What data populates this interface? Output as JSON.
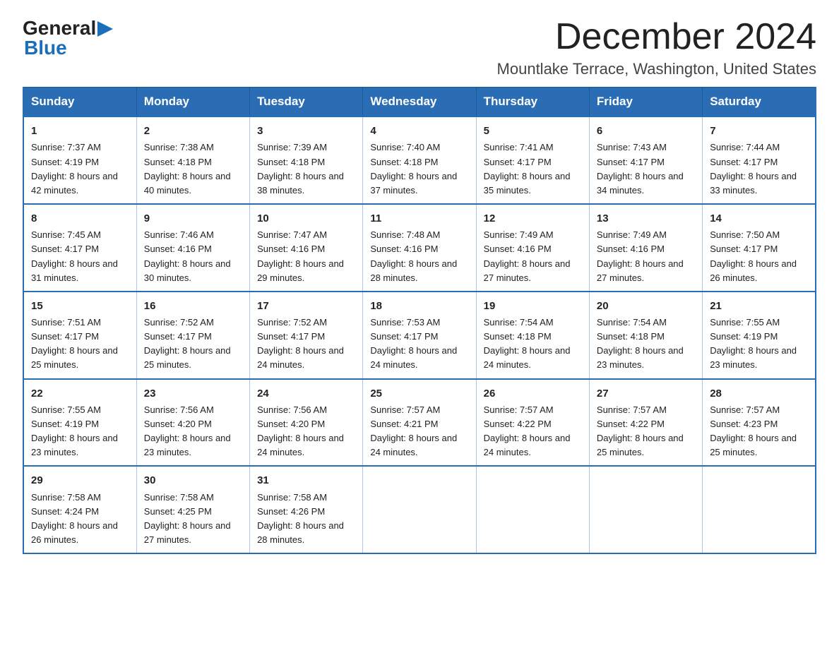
{
  "logo": {
    "text_general": "General",
    "text_blue": "Blue",
    "arrow": "▶"
  },
  "title": "December 2024",
  "subtitle": "Mountlake Terrace, Washington, United States",
  "days_of_week": [
    "Sunday",
    "Monday",
    "Tuesday",
    "Wednesday",
    "Thursday",
    "Friday",
    "Saturday"
  ],
  "weeks": [
    [
      {
        "day": "1",
        "sunrise": "7:37 AM",
        "sunset": "4:19 PM",
        "daylight": "8 hours and 42 minutes."
      },
      {
        "day": "2",
        "sunrise": "7:38 AM",
        "sunset": "4:18 PM",
        "daylight": "8 hours and 40 minutes."
      },
      {
        "day": "3",
        "sunrise": "7:39 AM",
        "sunset": "4:18 PM",
        "daylight": "8 hours and 38 minutes."
      },
      {
        "day": "4",
        "sunrise": "7:40 AM",
        "sunset": "4:18 PM",
        "daylight": "8 hours and 37 minutes."
      },
      {
        "day": "5",
        "sunrise": "7:41 AM",
        "sunset": "4:17 PM",
        "daylight": "8 hours and 35 minutes."
      },
      {
        "day": "6",
        "sunrise": "7:43 AM",
        "sunset": "4:17 PM",
        "daylight": "8 hours and 34 minutes."
      },
      {
        "day": "7",
        "sunrise": "7:44 AM",
        "sunset": "4:17 PM",
        "daylight": "8 hours and 33 minutes."
      }
    ],
    [
      {
        "day": "8",
        "sunrise": "7:45 AM",
        "sunset": "4:17 PM",
        "daylight": "8 hours and 31 minutes."
      },
      {
        "day": "9",
        "sunrise": "7:46 AM",
        "sunset": "4:16 PM",
        "daylight": "8 hours and 30 minutes."
      },
      {
        "day": "10",
        "sunrise": "7:47 AM",
        "sunset": "4:16 PM",
        "daylight": "8 hours and 29 minutes."
      },
      {
        "day": "11",
        "sunrise": "7:48 AM",
        "sunset": "4:16 PM",
        "daylight": "8 hours and 28 minutes."
      },
      {
        "day": "12",
        "sunrise": "7:49 AM",
        "sunset": "4:16 PM",
        "daylight": "8 hours and 27 minutes."
      },
      {
        "day": "13",
        "sunrise": "7:49 AM",
        "sunset": "4:16 PM",
        "daylight": "8 hours and 27 minutes."
      },
      {
        "day": "14",
        "sunrise": "7:50 AM",
        "sunset": "4:17 PM",
        "daylight": "8 hours and 26 minutes."
      }
    ],
    [
      {
        "day": "15",
        "sunrise": "7:51 AM",
        "sunset": "4:17 PM",
        "daylight": "8 hours and 25 minutes."
      },
      {
        "day": "16",
        "sunrise": "7:52 AM",
        "sunset": "4:17 PM",
        "daylight": "8 hours and 25 minutes."
      },
      {
        "day": "17",
        "sunrise": "7:52 AM",
        "sunset": "4:17 PM",
        "daylight": "8 hours and 24 minutes."
      },
      {
        "day": "18",
        "sunrise": "7:53 AM",
        "sunset": "4:17 PM",
        "daylight": "8 hours and 24 minutes."
      },
      {
        "day": "19",
        "sunrise": "7:54 AM",
        "sunset": "4:18 PM",
        "daylight": "8 hours and 24 minutes."
      },
      {
        "day": "20",
        "sunrise": "7:54 AM",
        "sunset": "4:18 PM",
        "daylight": "8 hours and 23 minutes."
      },
      {
        "day": "21",
        "sunrise": "7:55 AM",
        "sunset": "4:19 PM",
        "daylight": "8 hours and 23 minutes."
      }
    ],
    [
      {
        "day": "22",
        "sunrise": "7:55 AM",
        "sunset": "4:19 PM",
        "daylight": "8 hours and 23 minutes."
      },
      {
        "day": "23",
        "sunrise": "7:56 AM",
        "sunset": "4:20 PM",
        "daylight": "8 hours and 23 minutes."
      },
      {
        "day": "24",
        "sunrise": "7:56 AM",
        "sunset": "4:20 PM",
        "daylight": "8 hours and 24 minutes."
      },
      {
        "day": "25",
        "sunrise": "7:57 AM",
        "sunset": "4:21 PM",
        "daylight": "8 hours and 24 minutes."
      },
      {
        "day": "26",
        "sunrise": "7:57 AM",
        "sunset": "4:22 PM",
        "daylight": "8 hours and 24 minutes."
      },
      {
        "day": "27",
        "sunrise": "7:57 AM",
        "sunset": "4:22 PM",
        "daylight": "8 hours and 25 minutes."
      },
      {
        "day": "28",
        "sunrise": "7:57 AM",
        "sunset": "4:23 PM",
        "daylight": "8 hours and 25 minutes."
      }
    ],
    [
      {
        "day": "29",
        "sunrise": "7:58 AM",
        "sunset": "4:24 PM",
        "daylight": "8 hours and 26 minutes."
      },
      {
        "day": "30",
        "sunrise": "7:58 AM",
        "sunset": "4:25 PM",
        "daylight": "8 hours and 27 minutes."
      },
      {
        "day": "31",
        "sunrise": "7:58 AM",
        "sunset": "4:26 PM",
        "daylight": "8 hours and 28 minutes."
      },
      null,
      null,
      null,
      null
    ]
  ],
  "labels": {
    "sunrise": "Sunrise:",
    "sunset": "Sunset:",
    "daylight": "Daylight:"
  }
}
